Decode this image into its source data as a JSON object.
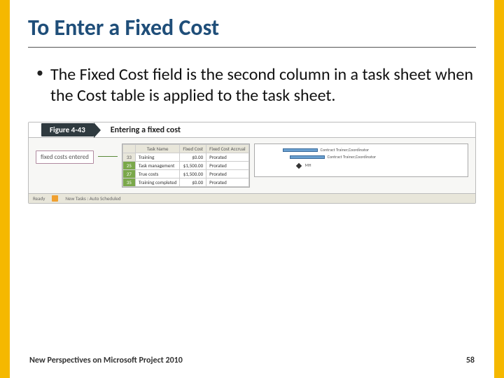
{
  "slide": {
    "title": "To Enter a Fixed Cost",
    "bullet": "The Fixed Cost field is the second column in a task sheet when the Cost table is applied to the task sheet."
  },
  "figure": {
    "label": "Figure 4-43",
    "caption": "Entering a fixed cost",
    "callout": "fixed costs entered",
    "headers": [
      "",
      "Task Name",
      "Fixed Cost",
      "Fixed Cost Accrual"
    ],
    "rows": [
      {
        "num": "33",
        "hl": false,
        "name": "Training",
        "cost": "$0.00",
        "accrual": "Prorated"
      },
      {
        "num": "25",
        "hl": true,
        "name": "Task management",
        "cost": "$1,500.00",
        "accrual": "Prorated"
      },
      {
        "num": "27",
        "hl": true,
        "name": "True costs",
        "cost": "$1,500.00",
        "accrual": "Prorated"
      },
      {
        "num": "35",
        "hl": true,
        "name": "Training completed",
        "cost": "$0.00",
        "accrual": "Prorated"
      }
    ],
    "gantt_labels": [
      "Contract Trainer,Coordinator",
      "Contract Trainer,Coordinator",
      "MH"
    ],
    "status": {
      "ready": "Ready",
      "mode": "New Tasks : Auto Scheduled"
    }
  },
  "footer": {
    "left": "New Perspectives on Microsoft Project 2010",
    "right": "58"
  }
}
